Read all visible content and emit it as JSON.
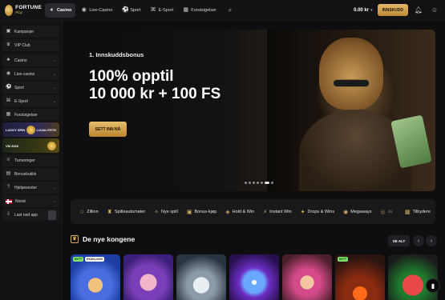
{
  "header": {
    "logo": {
      "name": "FORTUNE",
      "sub": "Play"
    },
    "nav": [
      {
        "label": "Casino",
        "icon": "casino-icon"
      },
      {
        "label": "Live-Casino",
        "icon": "live-casino-icon"
      },
      {
        "label": "Sport",
        "icon": "sport-icon"
      },
      {
        "label": "E-Sport",
        "icon": "esport-icon"
      },
      {
        "label": "Forutsigelser",
        "icon": "predictions-icon"
      }
    ],
    "balance": "0.00 kr",
    "deposit_label": "INNSKUDD"
  },
  "sidebar": {
    "items_top": [
      {
        "label": "Kampanjer",
        "icon": "gift-icon"
      },
      {
        "label": "VIP Club",
        "icon": "crown-icon"
      }
    ],
    "items_main": [
      {
        "label": "Casino",
        "icon": "cards-icon"
      },
      {
        "label": "Live-casino",
        "icon": "live-icon"
      },
      {
        "label": "Sport",
        "icon": "ball-icon"
      },
      {
        "label": "E-Sport",
        "icon": "gamepad-icon"
      },
      {
        "label": "Forutsigelser",
        "icon": "predictions-icon"
      }
    ],
    "promos": [
      {
        "label": "LUCKY SPIN",
        "extra": "LOJALITETS"
      },
      {
        "label": "VM 2026"
      }
    ],
    "items_bottom": [
      {
        "label": "Turneringer",
        "icon": "trophy-icon"
      },
      {
        "label": "Bonusbutikk",
        "icon": "shop-icon"
      },
      {
        "label": "Hjelpesenter",
        "icon": "help-icon"
      },
      {
        "label": "Norsk",
        "icon": "flag-icon"
      },
      {
        "label": "Last ned app",
        "icon": "download-icon"
      }
    ]
  },
  "hero": {
    "subtitle": "1. Innskuddsbonus",
    "title_line1": "100% opptil",
    "title_line2": "10 000 kr + 100 FS",
    "cta": "SETT INN NÅ"
  },
  "categories": [
    {
      "label": "Zillion",
      "icon": "star-icon"
    },
    {
      "label": "Spilleautomater",
      "icon": "slot-icon"
    },
    {
      "label": "Nye spill",
      "icon": "new-icon"
    },
    {
      "label": "Bonus-kjøp",
      "icon": "bonus-icon"
    },
    {
      "label": "Hold & Win",
      "icon": "hold-icon"
    },
    {
      "label": "Instant Win",
      "icon": "instant-icon"
    },
    {
      "label": "Drops & Wins",
      "icon": "drops-icon"
    },
    {
      "label": "Megaways",
      "icon": "megaways-icon"
    },
    {
      "label": "Ja",
      "icon": "jackpot-icon"
    }
  ],
  "category_last": {
    "label": "Tilbydere",
    "icon": "providers-icon"
  },
  "section": {
    "title": "De nye kongene",
    "see_all": "SE ALT"
  },
  "games": [
    {
      "badges": [
        "NYTT",
        "EKSKLUSIV"
      ]
    },
    {
      "badges": []
    },
    {
      "badges": []
    },
    {
      "badges": []
    },
    {
      "badges": []
    },
    {
      "badges": [
        "NYTT"
      ]
    },
    {
      "badges": []
    }
  ]
}
